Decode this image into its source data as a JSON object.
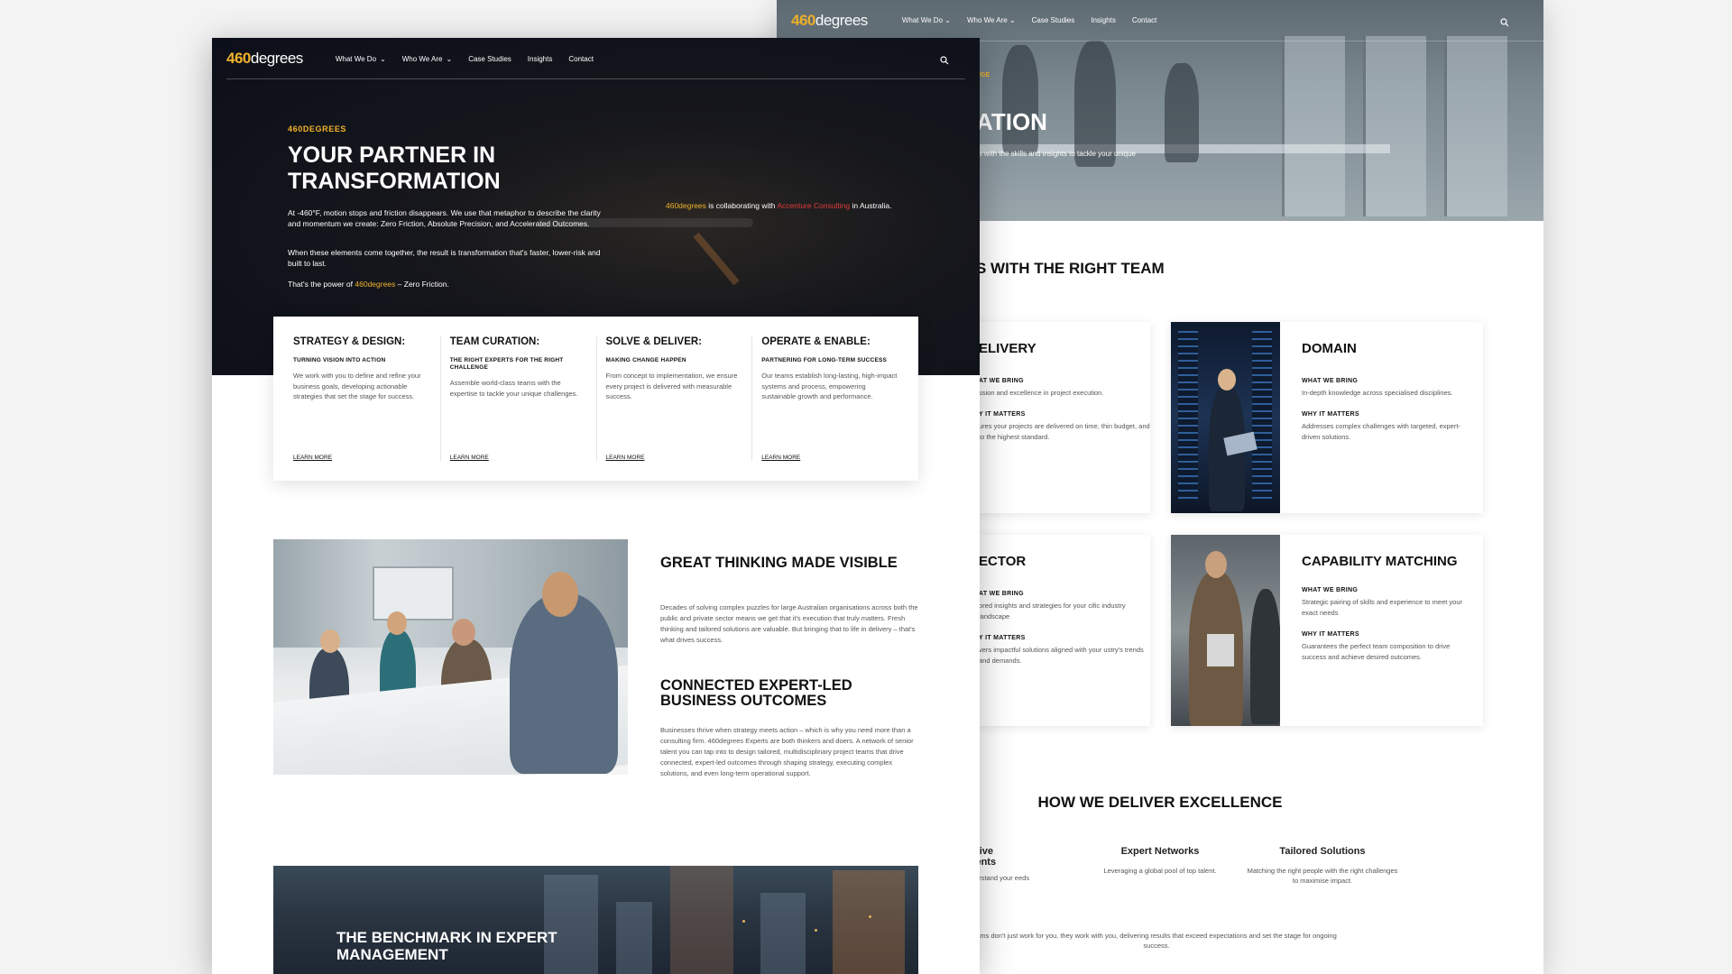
{
  "brand": {
    "num": "460",
    "word": "degrees"
  },
  "nav": {
    "items": [
      "What We Do",
      "Who We Are",
      "Case Studies",
      "Insights",
      "Contact"
    ]
  },
  "front": {
    "kicker": "460DEGREES",
    "title": "YOUR PARTNER IN TRANSFORMATION",
    "p1": "At -460°F, motion stops and friction disappears. We use that metaphor to describe the clarity and momentum we create: Zero Friction, Absolute Precision, and Accelerated Outcomes.",
    "p2": "When these elements come together, the result is transformation that's faster, lower-risk and built to last.",
    "p3_pre": "That's the power of ",
    "p3_brand": "460degrees",
    "p3_post": " – Zero Friction.",
    "side_brand": "460degrees",
    "side_mid": " is collaborating with ",
    "side_partner": "Accenture Consulting",
    "side_post": " in Australia.",
    "services": [
      {
        "title": "STRATEGY & DESIGN:",
        "sub": "TURNING VISION INTO ACTION",
        "body": "We work with you to define and refine your business goals, developing actionable strategies that set the stage for success.",
        "link": "LEARN MORE"
      },
      {
        "title": "TEAM CURATION:",
        "sub": "THE RIGHT EXPERTS FOR THE RIGHT CHALLENGE",
        "body": "Assemble world-class teams with the expertise to tackle your unique challenges.",
        "link": "LEARN MORE"
      },
      {
        "title": "SOLVE & DELIVER:",
        "sub": "MAKING CHANGE HAPPEN",
        "body": "From concept to implementation, we ensure every project is delivered with measurable success.",
        "link": "LEARN MORE"
      },
      {
        "title": "OPERATE & ENABLE:",
        "sub": "PARTNERING FOR LONG-TERM SUCCESS",
        "body": "Our teams establish long-lasting, high-impact systems and process, empowering sustainable growth and performance.",
        "link": "LEARN MORE"
      }
    ],
    "great_title": "GREAT THINKING MADE VISIBLE",
    "great_body": "Decades of solving complex puzzles for large Australian organisations across both the public and private sector means we get that it's execution that truly matters. Fresh thinking and tailored solutions are valuable. But bringing that to life in delivery – that's what drives success.",
    "connected_title": "CONNECTED EXPERT-LED BUSINESS OUTCOMES",
    "connected_body": "Businesses thrive when strategy meets action – which is why you need more than a consulting firm. 460degrees Experts are both thinkers and doers. A network of senior talent you can tap into to design tailored, multidisciplinary project teams that drive connected, expert-led outcomes through shaping strategy, executing complex solutions, and even long-term operational support.",
    "bench_title": "THE BENCHMARK IN EXPERT MANAGEMENT"
  },
  "back": {
    "hero_kicker": "UGE",
    "hero_title": "ATION",
    "hero_sub": "rs with the skills and insights to tackle your unique",
    "h2": "S WITH THE RIGHT TEAM",
    "cut_cards": [
      {
        "title": "ELIVERY",
        "h1": "AT WE BRING",
        "p1": "ssion and excellence in project execution.",
        "h2": "Y IT MATTERS",
        "p2": "ures your projects are delivered on time, thin budget, and to the highest standard."
      },
      {
        "title": "ECTOR",
        "h1": "AT WE BRING",
        "p1": "ored insights and strategies for your cific industry landscape",
        "h2": "Y IT MATTERS",
        "p2": "vers impactful solutions aligned with your ustry's trends and demands."
      }
    ],
    "cards": [
      {
        "title": "DOMAIN",
        "h1": "WHAT WE BRING",
        "p1": "In-depth knowledge across specialised disciplines.",
        "h2": "WHY IT MATTERS",
        "p2": "Addresses complex challenges with targeted, expert-driven solutions."
      },
      {
        "title": "CAPABILITY MATCHING",
        "h1": "WHAT WE BRING",
        "p1": "Strategic pairing of skills and experience to meet your exact needs",
        "h2": "WHY IT MATTERS",
        "p2": "Guarantees the perfect team composition to drive success and achieve desired outcomes."
      }
    ],
    "excellence_title": "HOW WE DELIVER EXCELLENCE",
    "excellence": [
      {
        "title": "llaborative gagements",
        "body": "you to understand your eeds deeply"
      },
      {
        "title": "Expert Networks",
        "body": "Leveraging a global pool of top talent."
      },
      {
        "title": "Tailored Solutions",
        "body": "Matching the right people with the right challenges to maximise impact."
      }
    ],
    "footnote": "ams don't just work for you, they work with you, delivering results that exceed expectations and set the stage for ongoing success."
  }
}
